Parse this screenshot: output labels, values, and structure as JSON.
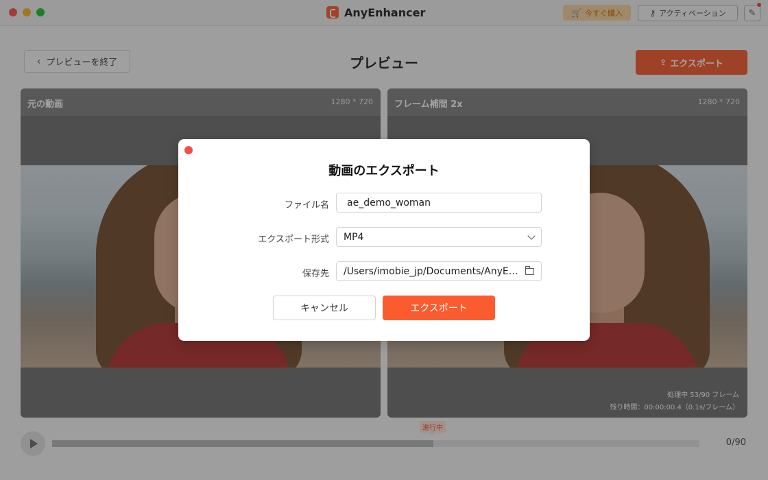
{
  "window": {
    "app_name": "AnyEnhancer",
    "buy_label": "今すぐ購入",
    "activate_label": "アクティベーション",
    "edit_icon": "edit-icon"
  },
  "toolbar": {
    "back_label": "プレビューを終了",
    "title": "プレビュー",
    "export_label": "エクスポート"
  },
  "panels": {
    "original": {
      "label": "元の動画",
      "resolution": "1280 * 720"
    },
    "enhanced": {
      "label": "フレーム補間 2x",
      "resolution": "1280 * 720"
    }
  },
  "processing": {
    "status": "処理中 53/90 フレーム",
    "remaining": "残り時間：00:00:00.4（0.1s/フレーム）"
  },
  "playback": {
    "progress_tag": "進行中",
    "frame_count": "0/90",
    "progress_fraction": 0.589
  },
  "dialog": {
    "title": "動画のエクスポート",
    "file_label": "ファイル名",
    "file_value": "ae_demo_woman",
    "format_label": "エクスポート形式",
    "format_value": "MP4",
    "dest_label": "保存先",
    "dest_value": "/Users/imobie_jp/Documents/AnyEnhancer",
    "cancel_label": "キャンセル",
    "confirm_label": "エクスポート"
  },
  "colors": {
    "accent": "#fb5c2f",
    "close": "#fe5f57",
    "minimize": "#febc2e",
    "maximize": "#28c840"
  }
}
